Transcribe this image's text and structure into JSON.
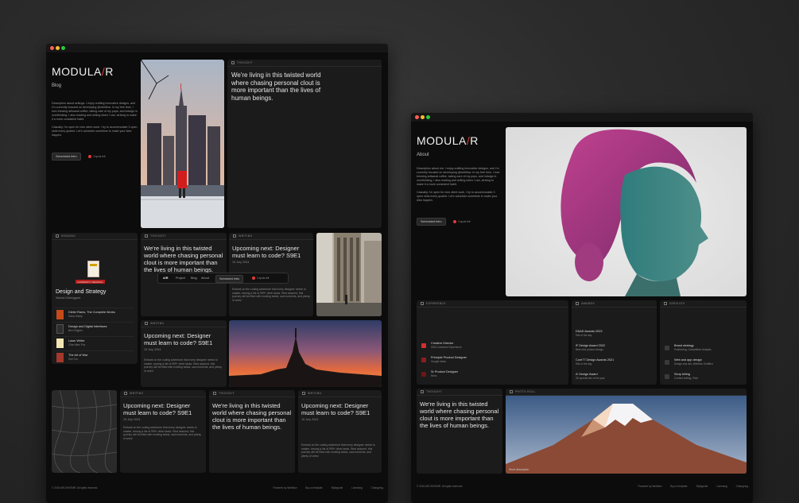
{
  "colors": {
    "accent": "#e53935",
    "window_bg": "#0c0c0c",
    "card_bg": "#1b1b1b"
  },
  "left_window": {
    "logo_main": "MODULA",
    "logo_slash": "/",
    "logo_end": "R",
    "subtitle": "Blog",
    "desc_p1": "Description about writings. I enjoy crafting innovative designs, and I'm currently focused on developing @webflow. In my free time, I love brewing artisanal coffee, taking care of my pups, and indulge in overthinking. I also reading and writing when I can, striving to make it a more consistent habit.",
    "desc_p2": "Casually, I'm open for new client work. I try to accommodate 3 open slots every quarter. Let's schedule sometime to make your idea happen.",
    "schedule_label": "Scheduled Intro",
    "spots_label": "3 spots left",
    "thought_head": "Thought",
    "quote": "We're living in this twisted world where chasing personal clout is more important than the lives of human beings.",
    "reading_head": "Reading",
    "book_title": "Design and Strategy",
    "book_author": "Wanda Dickinggard",
    "book_badge": "CURRENTLY READING",
    "books": [
      {
        "title": "Dieter Rams, The Complete Works",
        "author": "Klaus Klemp"
      },
      {
        "title": "Design and Digital Interfaces",
        "author": "Ben Gingher"
      },
      {
        "title": "Laser Writer",
        "author": "Clive Allen Pos"
      },
      {
        "title": "The Art of War",
        "author": "Sun Tzu"
      }
    ],
    "writing_head": "Writing",
    "writing_title": "Upcoming next: Designer must learn to code? S9E1",
    "writing_date": "15 July 2024",
    "writing_body": "Embark on the coding adventure that every designer needs to master, among a list of 999+ other tasks. Rest assured, this journey will be filled with exciting twists, sad moments, and plenty of cries!",
    "nav": {
      "logo": "A/R",
      "project": "Project",
      "blog": "Blog",
      "about": "About",
      "schedule": "Scheduled Intro",
      "spots": "3 spots left"
    },
    "footer_copy": "© 2024 ARCHIVEMR. All rights reserved.",
    "footer_links": [
      "Powered by Webflow",
      "Buy a template",
      "Styleguide",
      "Licensing",
      "Changelog"
    ]
  },
  "right_window": {
    "subtitle": "About",
    "desc_p1": "Description about me. I enjoy crafting innovative designs, and I'm currently focused on developing @webflow. In my free time, I love brewing artisanal coffee, taking care of my pups, and indulge in overthinking. I also reading and writing when I can, striving to make it a more consistent habit.",
    "desc_p2": "Casually, I'm open for new client work. I try to accommodate 3 open slots every quarter. Let's schedule sometime to make your idea happen.",
    "experience_head": "Experience",
    "experience": [
      {
        "title": "Creative Director",
        "sub": "IKEA Customer Experience"
      },
      {
        "title": "Principle Product Designer",
        "sub": "Google Ideas"
      },
      {
        "title": "Sr Product Designer",
        "sub": "Nexo"
      }
    ],
    "awards_head": "Awards",
    "awards": [
      {
        "title": "D&AD Awards 2023",
        "sub": "Site of the day"
      },
      {
        "title": "iF Design Award 2022",
        "sub": "Best new product design"
      },
      {
        "title": "Core77 Design Awards 2021",
        "sub": "Site of the day"
      },
      {
        "title": "A' Design Award",
        "sub": "3D special site of the year"
      }
    ],
    "services_head": "Services",
    "services": [
      {
        "title": "Brand strategy",
        "sub": "Positioning, Competitive Analysis"
      },
      {
        "title": "Web and app design",
        "sub": "Design and dev, Webflow Certified"
      },
      {
        "title": "Story telling",
        "sub": "Content writing, Pitch"
      }
    ],
    "thought_head": "Thought",
    "photo_head": "Photo Roll",
    "photo_caption": "Short description"
  }
}
